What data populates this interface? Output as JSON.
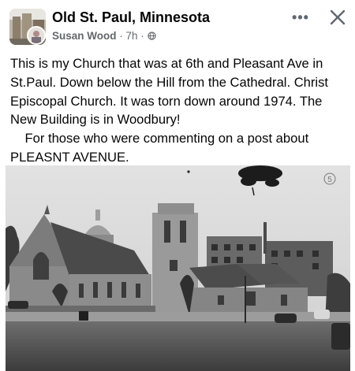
{
  "header": {
    "group_name": "Old St. Paul, Minnesota",
    "author": "Susan Wood",
    "separator": " · ",
    "time": "7h",
    "audience_icon": "globe-icon",
    "more_label": "•••",
    "close_icon": "close-icon"
  },
  "post": {
    "paragraph_1": "This is my Church that was at 6th and Pleasant Ave in St.Paul. Down below the Hill from the Cathedral. Christ Episcopal Church. It was torn down around 1974. The New Building is in Woodbury!",
    "paragraph_2": "For those who were commenting on a post about PLEASNT AVENUE."
  },
  "photo": {
    "number_label": "5",
    "subject": "black-and-white photo of a stone church at a street corner"
  },
  "colors": {
    "text": "#050505",
    "secondary_text": "#65676b",
    "background": "#ffffff"
  }
}
